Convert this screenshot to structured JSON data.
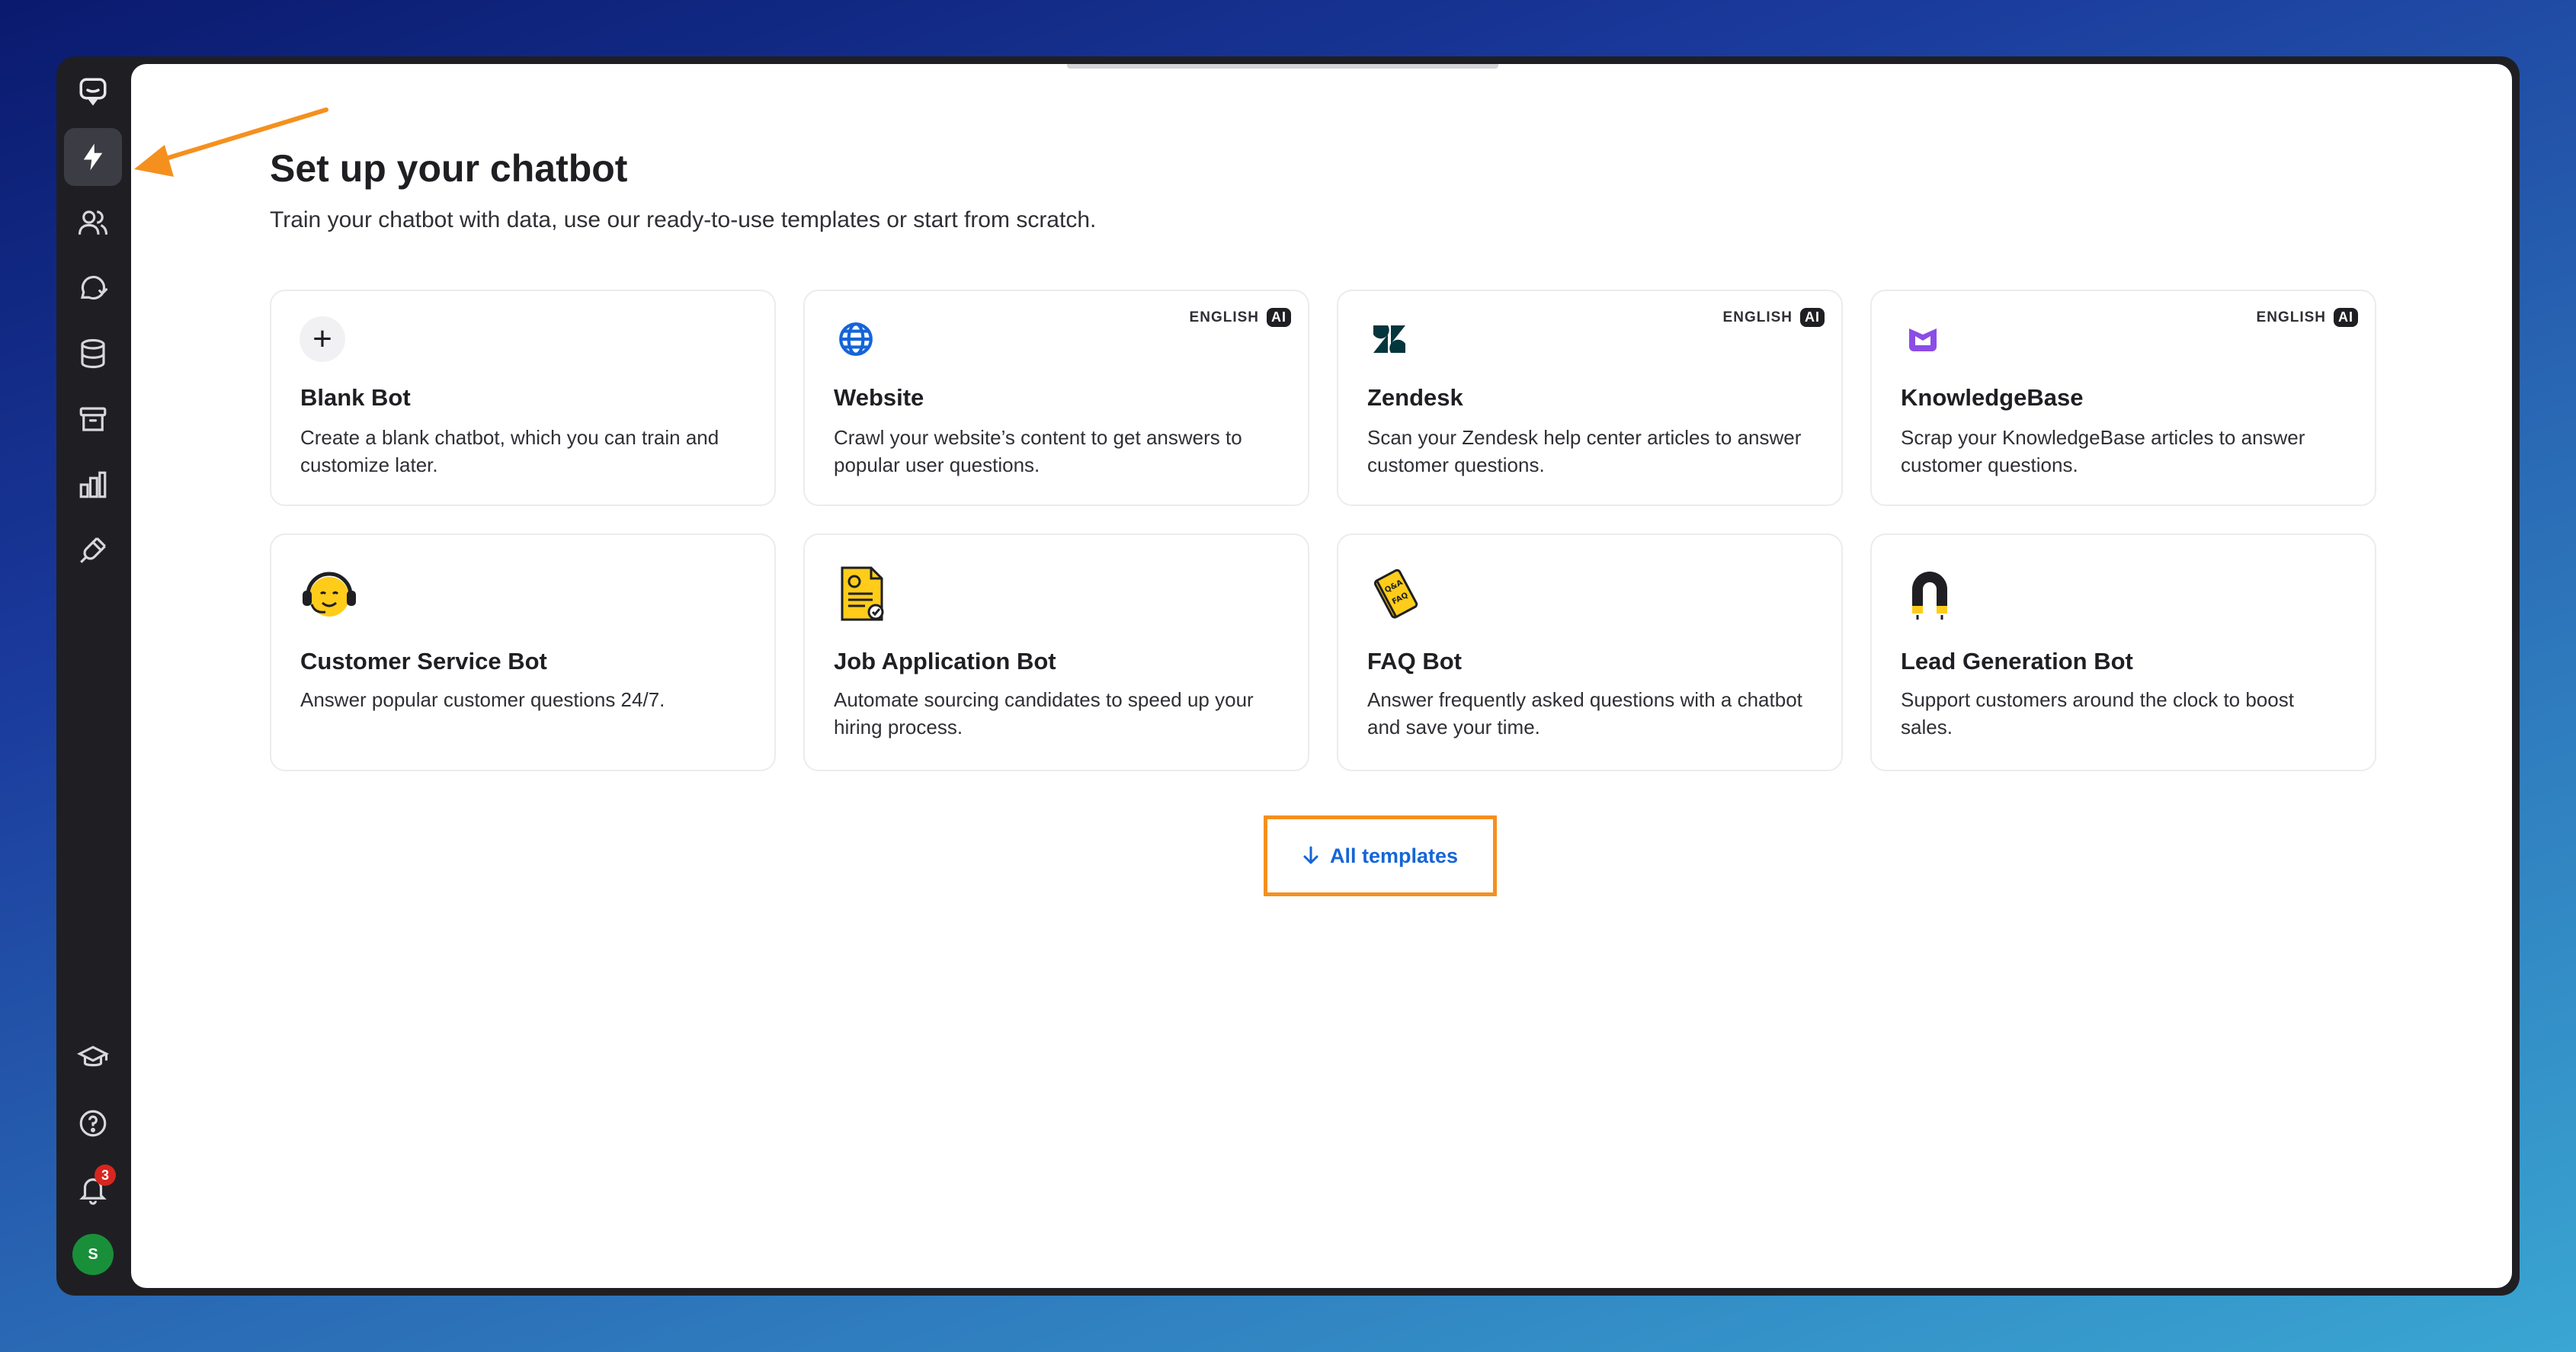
{
  "sidebar": {
    "top_items": [
      {
        "icon": "chat-logo-icon",
        "active": false
      },
      {
        "icon": "lightning-icon",
        "active": true
      },
      {
        "icon": "users-icon",
        "active": false
      },
      {
        "icon": "chat-question-icon",
        "active": false
      },
      {
        "icon": "database-icon",
        "active": false
      },
      {
        "icon": "archive-icon",
        "active": false
      },
      {
        "icon": "bar-chart-icon",
        "active": false
      },
      {
        "icon": "plug-icon",
        "active": false
      }
    ],
    "bottom_items": [
      {
        "icon": "graduation-cap-icon"
      },
      {
        "icon": "help-circle-icon"
      },
      {
        "icon": "bell-icon",
        "badge": "3"
      }
    ],
    "avatar_initial": "S"
  },
  "main": {
    "title": "Set up your chatbot",
    "subtitle": "Train your chatbot with data, use our ready-to-use templates or start from scratch.",
    "cards": [
      {
        "title": "Blank Bot",
        "desc": "Create a blank chatbot, which you can train and customize later.",
        "icon": "plus-icon"
      },
      {
        "title": "Website",
        "desc": "Crawl your website’s content to get answers to popular user questions.",
        "icon": "globe-icon",
        "lang": "ENGLISH",
        "ai": "AI"
      },
      {
        "title": "Zendesk",
        "desc": "Scan your Zendesk help center articles to answer customer questions.",
        "icon": "zendesk-icon",
        "lang": "ENGLISH",
        "ai": "AI"
      },
      {
        "title": "KnowledgeBase",
        "desc": "Scrap your KnowledgeBase articles to answer customer questions.",
        "icon": "knowledgebase-icon",
        "lang": "ENGLISH",
        "ai": "AI"
      },
      {
        "title": "Customer Service Bot",
        "desc": "Answer popular customer questions 24/7.",
        "icon": "headset-emoji-icon"
      },
      {
        "title": "Job Application Bot",
        "desc": "Automate sourcing candidates to speed up your hiring process.",
        "icon": "resume-document-icon"
      },
      {
        "title": "FAQ Bot",
        "desc": "Answer frequently asked questions with a chatbot and save your time.",
        "icon": "faq-book-icon"
      },
      {
        "title": "Lead Generation Bot",
        "desc": "Support customers around the clock to boost sales.",
        "icon": "magnet-icon"
      }
    ],
    "all_templates": {
      "label": "All templates",
      "icon": "arrow-down-icon"
    }
  },
  "colors": {
    "accent_blue": "#1565d8",
    "highlight_orange": "#f5901e",
    "sidebar_bg": "#1f1f23",
    "badge_red": "#d6261f",
    "avatar_green": "#1a8f3a"
  }
}
